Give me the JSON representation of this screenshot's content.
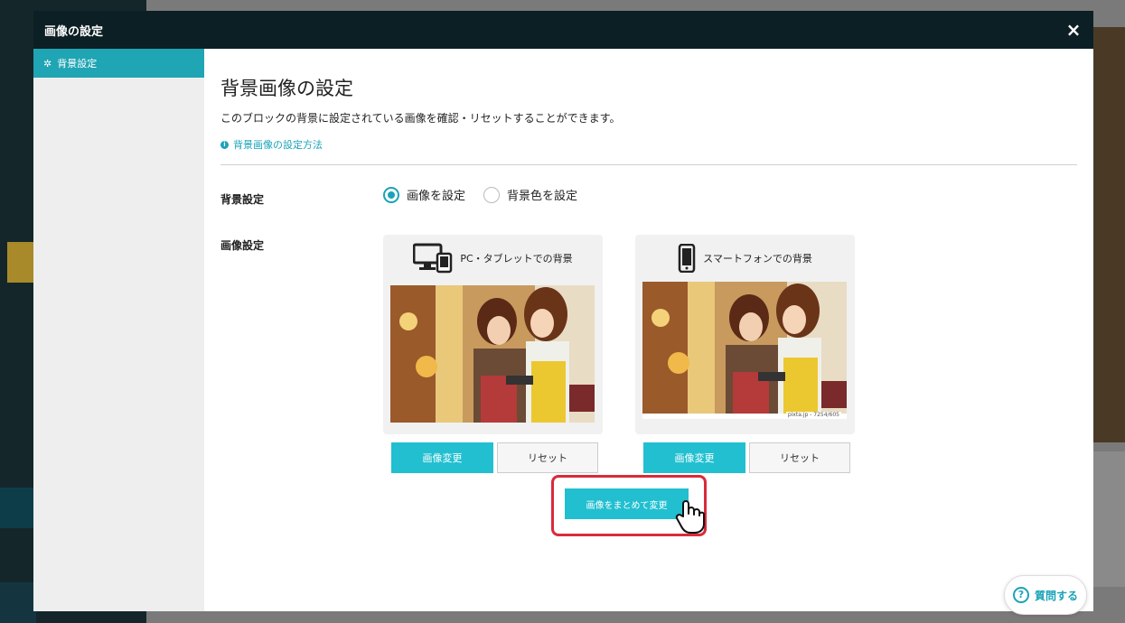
{
  "modal": {
    "title": "画像の設定",
    "close_label": "×"
  },
  "sidebar": {
    "items": [
      {
        "label": "背景設定",
        "icon": "gear-icon",
        "active": true
      }
    ]
  },
  "content": {
    "heading": "背景画像の設定",
    "description": "このブロックの背景に設定されている画像を確認・リセットすることができます。",
    "help_link": "背景画像の設定方法",
    "background_setting": {
      "label": "背景設定",
      "options": [
        {
          "label": "画像を設定",
          "checked": true
        },
        {
          "label": "背景色を設定",
          "checked": false
        }
      ]
    },
    "image_setting": {
      "label": "画像設定",
      "cards": [
        {
          "title": "PC・タブレットでの背景",
          "icon": "desktop-tablet-icon",
          "change_label": "画像変更",
          "reset_label": "リセット",
          "credit": ""
        },
        {
          "title": "スマートフォンでの背景",
          "icon": "smartphone-icon",
          "change_label": "画像変更",
          "reset_label": "リセット",
          "credit": "pixta.jp - 7254/605"
        }
      ],
      "bulk_change_label": "画像をまとめて変更"
    }
  },
  "help_widget": {
    "label": "質問する"
  },
  "colors": {
    "accent": "#21bfd0",
    "header": "#0c1f24",
    "highlight_border": "#d92b3b"
  }
}
